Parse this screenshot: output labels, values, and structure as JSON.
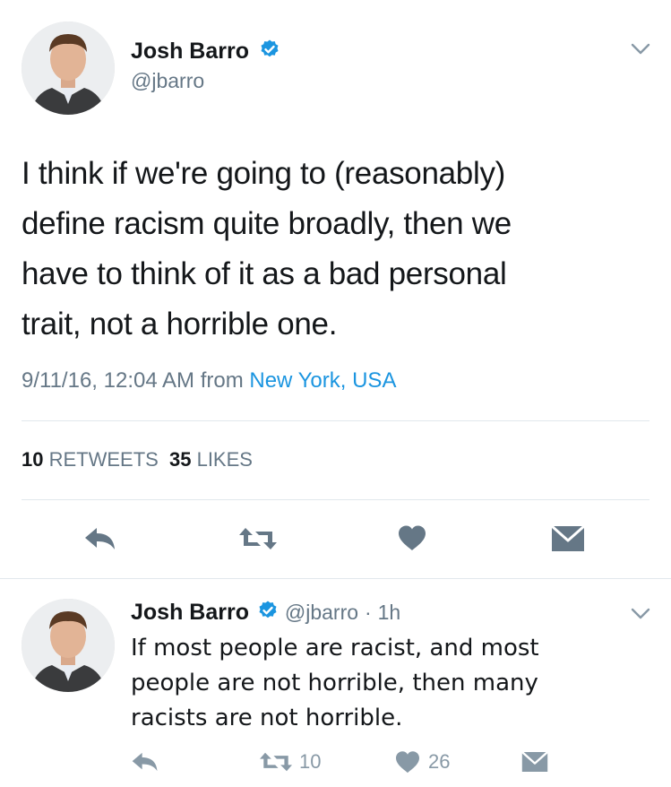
{
  "colors": {
    "accent": "#1b95e0",
    "icon_gray": "#657786",
    "divider": "#e1e8ed",
    "text": "#14171a"
  },
  "main_tweet": {
    "author_name": "Josh Barro",
    "author_handle": "@jbarro",
    "text_lines": [
      "I think if we're going to (reasonably)",
      "define racism quite broadly, then we",
      "have to think of it as a bad personal",
      "trait, not a horrible one."
    ],
    "timestamp": "9/11/16, 12:04 AM",
    "from_label": "from",
    "location": "New York, USA",
    "retweets_count": "10",
    "retweets_label": "RETWEETS",
    "likes_count": "35",
    "likes_label": "LIKES",
    "icons": [
      "reply-icon",
      "retweet-icon",
      "like-icon",
      "message-icon"
    ]
  },
  "reply_tweet": {
    "author_name": "Josh Barro",
    "author_handle": "@jbarro",
    "separator": "·",
    "time_ago": "1h",
    "text_lines": [
      "If most people are racist, and most",
      "people are not horrible, then many",
      "racists are not horrible."
    ],
    "retweet_count": "10",
    "like_count": "26"
  }
}
